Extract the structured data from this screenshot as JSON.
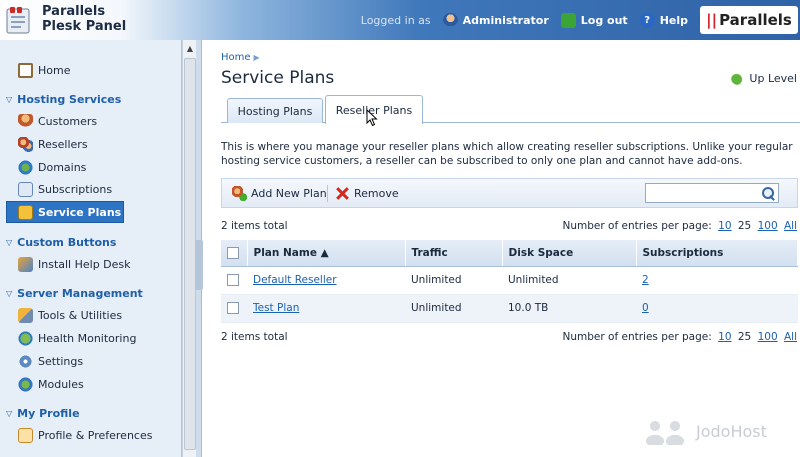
{
  "header": {
    "brand_line1": "Parallels",
    "brand_line2": "Plesk Panel",
    "logged_in_label": "Logged in as",
    "user": "Administrator",
    "logout": "Log out",
    "help": "Help",
    "vendor_logo": "Parallels"
  },
  "sidebar": {
    "home": "Home",
    "groups": [
      {
        "title": "Hosting Services",
        "items": [
          "Customers",
          "Resellers",
          "Domains",
          "Subscriptions",
          "Service Plans"
        ]
      },
      {
        "title": "Custom Buttons",
        "items": [
          "Install Help Desk"
        ]
      },
      {
        "title": "Server Management",
        "items": [
          "Tools & Utilities",
          "Health Monitoring",
          "Settings",
          "Modules"
        ]
      },
      {
        "title": "My Profile",
        "items": [
          "Profile & Preferences"
        ]
      }
    ],
    "active_item": "Service Plans"
  },
  "main": {
    "breadcrumb": "Home",
    "title": "Service Plans",
    "up_level": "Up Level",
    "tabs": [
      {
        "label": "Hosting Plans",
        "active": false
      },
      {
        "label": "Reseller Plans",
        "active": true
      }
    ],
    "description": "This is where you manage your reseller plans which allow creating reseller subscriptions. Unlike your regular hosting service customers, a reseller can be subscribed to only one plan and cannot have add-ons.",
    "toolbar": {
      "add": "Add New Plan",
      "remove": "Remove",
      "search_value": ""
    },
    "items_total": "2 items total",
    "entries_label": "Number of entries per page:",
    "entries_options": [
      "10",
      "25",
      "100",
      "All"
    ],
    "entries_current": "25",
    "table": {
      "columns": [
        "Plan Name ▲",
        "Traffic",
        "Disk Space",
        "Subscriptions"
      ],
      "rows": [
        {
          "name": "Default Reseller",
          "traffic": "Unlimited",
          "disk": "Unlimited",
          "subs": "2"
        },
        {
          "name": "Test Plan",
          "traffic": "Unlimited",
          "disk": "10.0 TB",
          "subs": "0"
        }
      ]
    }
  },
  "watermark": "JodoHost"
}
